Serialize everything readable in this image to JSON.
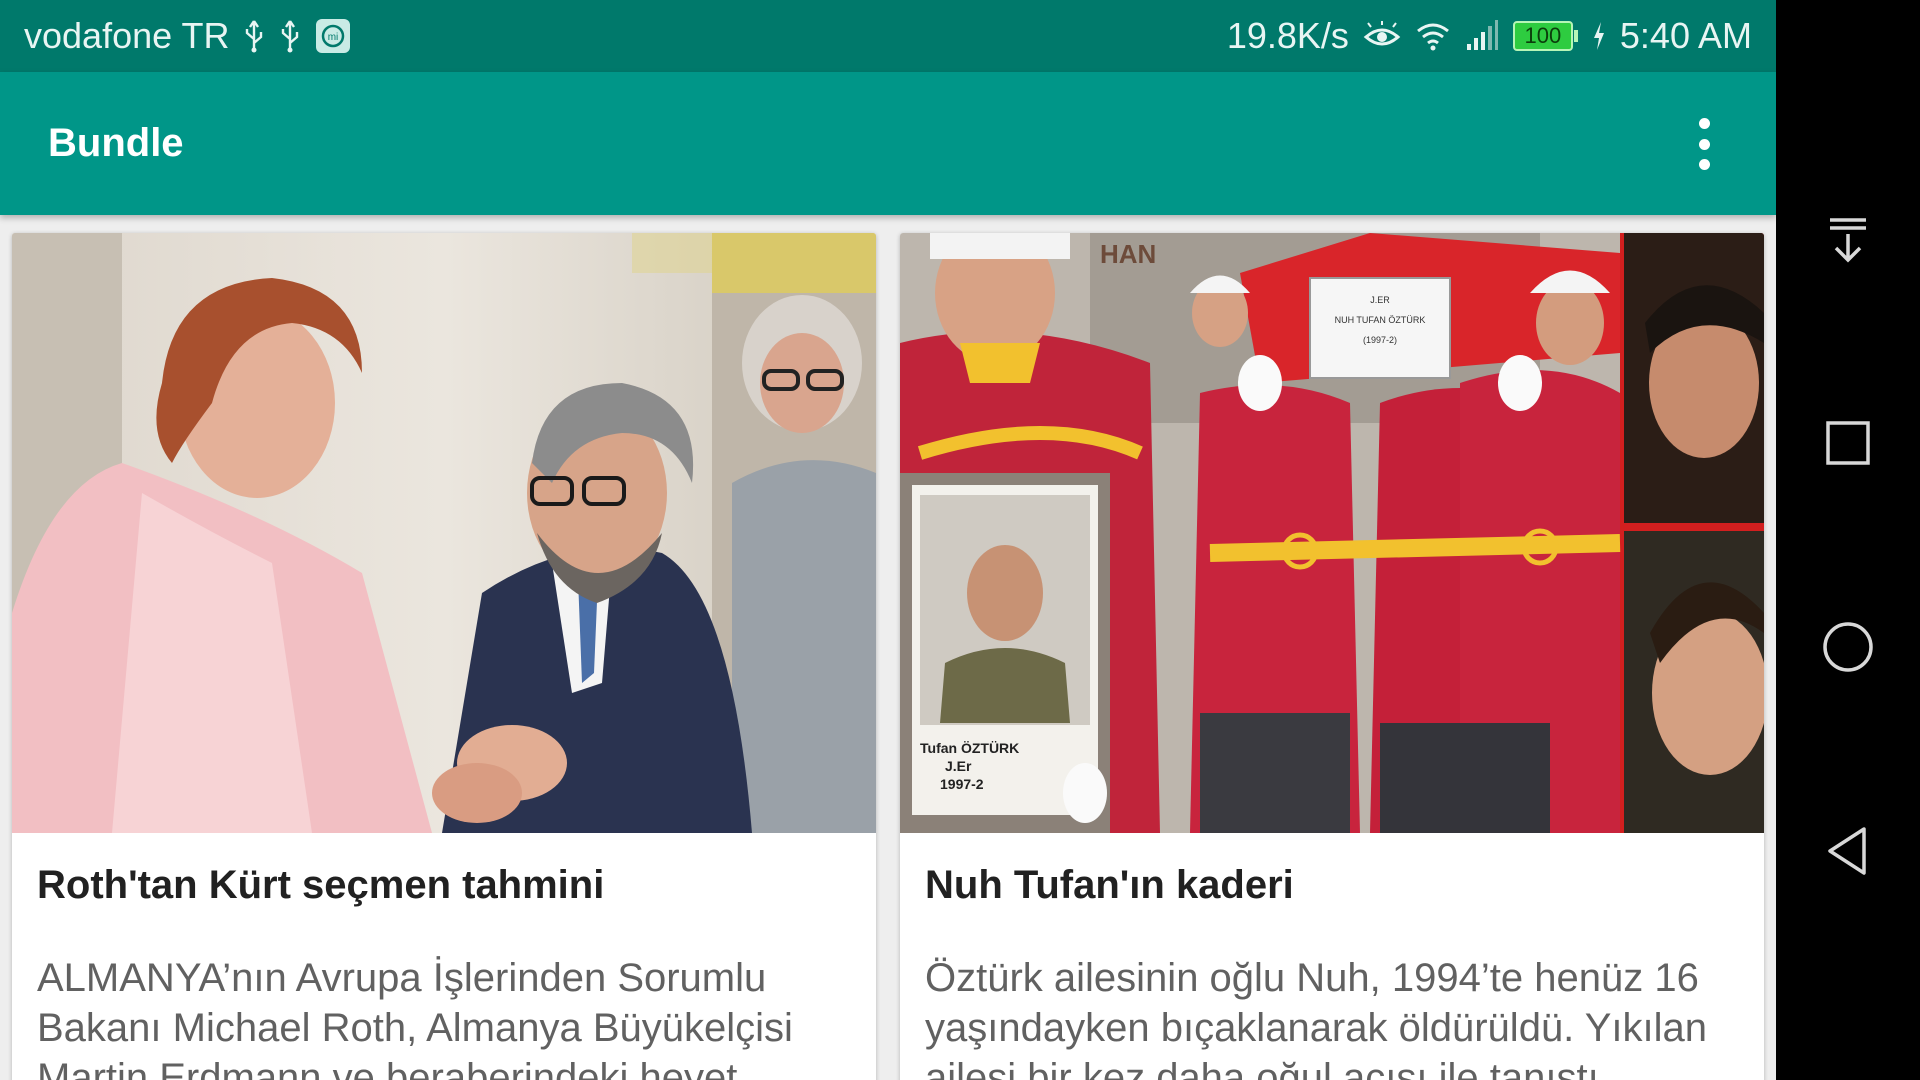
{
  "status_bar": {
    "carrier": "vodafone TR",
    "network_speed": "19.8K/s",
    "battery_level": "100",
    "time": "5:40 AM",
    "icons": [
      "usb-icon",
      "usb-icon",
      "mi-app-icon",
      "eye-icon",
      "wifi-icon",
      "signal-icon",
      "battery-icon",
      "charging-icon"
    ]
  },
  "app_bar": {
    "title": "Bundle",
    "overflow_icon": "more-vert-icon",
    "color": "#009688"
  },
  "cards": [
    {
      "image_description": "photo-handshake",
      "headline": "Roth'tan Kürt seçmen tahmini",
      "summary": "ALMANYA’nın Avrupa İşlerinden Sorumlu Bakanı Michael Roth, Almanya Büyükelçisi Martin Erdmann ve beraberindeki heyet..."
    },
    {
      "image_description": "photo-funeral",
      "photo_caption": [
        "Tufan ÖZTÜRK",
        "J.Er",
        "1997-2"
      ],
      "coffin_label": [
        "J.ER",
        "NUH TUFAN ÖZTÜRK",
        "(1997-2)"
      ],
      "sign_text": "HAN",
      "headline": "Nuh Tufan'ın kaderi",
      "summary": "Öztürk ailesinin oğlu Nuh, 1994’te henüz 16 yaşındayken bıçaklanarak öldürüldü. Yıkılan ailesi bir kez daha oğul acısı ile tanıştı."
    }
  ],
  "nav_bar": {
    "buttons": [
      "notification-pull-icon",
      "recents-icon",
      "home-icon",
      "back-icon"
    ]
  }
}
